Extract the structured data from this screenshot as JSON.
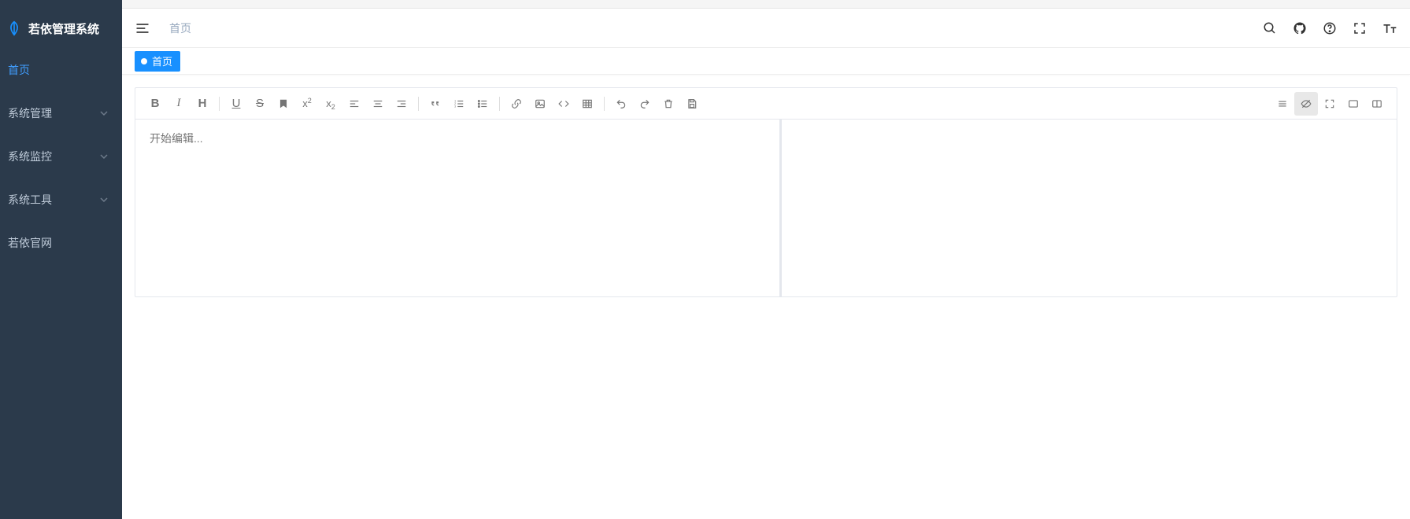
{
  "app_title": "若依管理系统",
  "sidebar": {
    "items": [
      {
        "label": "首页",
        "active": true,
        "expandable": false
      },
      {
        "label": "系统管理",
        "active": false,
        "expandable": true
      },
      {
        "label": "系统监控",
        "active": false,
        "expandable": true
      },
      {
        "label": "系统工具",
        "active": false,
        "expandable": true
      },
      {
        "label": "若依官网",
        "active": false,
        "expandable": false
      }
    ]
  },
  "header": {
    "breadcrumb": "首页",
    "icons": [
      "search",
      "github",
      "help",
      "fullscreen",
      "font-size"
    ]
  },
  "tabs": [
    {
      "label": "首页",
      "active": true
    }
  ],
  "editor": {
    "placeholder": "开始编辑...",
    "toolbar_left": [
      "bold",
      "italic",
      "heading",
      "sep",
      "underline",
      "strike",
      "mark",
      "superscript",
      "subscript",
      "align-left",
      "align-center",
      "align-right",
      "sep",
      "quote",
      "ol",
      "ul",
      "sep",
      "link",
      "image",
      "code",
      "table",
      "sep",
      "undo",
      "redo",
      "trash",
      "save"
    ],
    "toolbar_right": [
      "menu",
      "preview-toggle",
      "fullscreen",
      "read",
      "split"
    ],
    "toolbar_right_active": "preview-toggle"
  }
}
